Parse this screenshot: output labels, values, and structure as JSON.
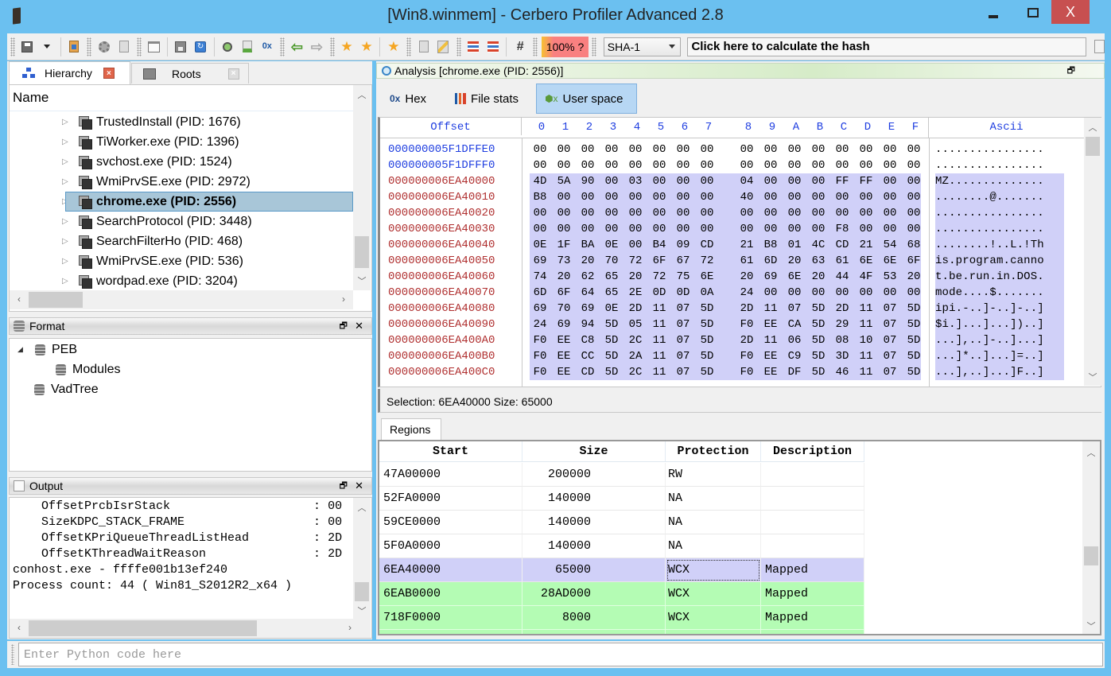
{
  "window": {
    "title": "[Win8.winmem] - Cerbero Profiler Advanced 2.8",
    "close_label": "X"
  },
  "toolbar": {
    "hash_progress": "100% ?",
    "hash_algorithm": "SHA-1",
    "hash_field": "Click here to calculate the hash",
    "icons": [
      "save-icon",
      "dropdown-icon",
      "import-icon",
      "settings-icon",
      "doc-settings-icon",
      "window-icon",
      "save-disk-icon",
      "refresh-icon",
      "zoom-icon",
      "add-doc-icon",
      "hex-add-icon",
      "back-arrow-icon",
      "forward-arrow-icon",
      "bookmark-globe-icon",
      "bookmark-star-icon",
      "add-bookmark-icon",
      "script-icon",
      "edit-icon",
      "layout-icon",
      "layout-search-icon",
      "hash-icon"
    ]
  },
  "left": {
    "tabs": [
      {
        "label": "Hierarchy",
        "active": true,
        "close": "×"
      },
      {
        "label": "Roots",
        "active": false,
        "close": "×"
      }
    ],
    "tree_header": "Name",
    "processes": [
      {
        "label": "TrustedInstall (PID: 1676)",
        "selected": false
      },
      {
        "label": "TiWorker.exe (PID: 1396)",
        "selected": false
      },
      {
        "label": "svchost.exe (PID: 1524)",
        "selected": false
      },
      {
        "label": "WmiPrvSE.exe (PID: 2972)",
        "selected": false
      },
      {
        "label": "chrome.exe (PID: 2556)",
        "selected": true
      },
      {
        "label": "SearchProtocol (PID: 3448)",
        "selected": false
      },
      {
        "label": "SearchFilterHo (PID: 468)",
        "selected": false
      },
      {
        "label": "WmiPrvSE.exe (PID: 536)",
        "selected": false
      },
      {
        "label": "wordpad.exe (PID: 3204)",
        "selected": false
      }
    ],
    "format": {
      "title": "Format",
      "items": [
        {
          "label": "PEB",
          "expanded": true,
          "level": 0
        },
        {
          "label": "Modules",
          "level": 1
        },
        {
          "label": "VadTree",
          "level": 0
        }
      ]
    },
    "output": {
      "title": "Output",
      "lines": [
        "    OffsetPrcbIsrStack                    : 00",
        "    SizeKDPC_STACK_FRAME                  : 00",
        "    OffsetKPriQueueThreadListHead         : 2D",
        "    OffsetKThreadWaitReason               : 2D",
        "conhost.exe - ffffe001b13ef240",
        "Process count: 44 ( Win81_S2012R2_x64 )"
      ]
    }
  },
  "python": {
    "placeholder": "Enter Python code here"
  },
  "analysis": {
    "title": "Analysis [chrome.exe (PID: 2556)]",
    "view_tabs": [
      {
        "label": "Hex",
        "icon": "0x"
      },
      {
        "label": "File stats",
        "icon": "bars"
      },
      {
        "label": "User space",
        "icon": "0x-green",
        "active": true
      }
    ],
    "hex": {
      "offset_header": "Offset",
      "columns": [
        "0",
        "1",
        "2",
        "3",
        "4",
        "5",
        "6",
        "7",
        "8",
        "9",
        "A",
        "B",
        "C",
        "D",
        "E",
        "F"
      ],
      "ascii_header": "Ascii",
      "rows": [
        {
          "addr": "000000005F1DFFE0",
          "hl": false,
          "bytes": [
            "00",
            "00",
            "00",
            "00",
            "00",
            "00",
            "00",
            "00",
            "00",
            "00",
            "00",
            "00",
            "00",
            "00",
            "00",
            "00"
          ],
          "ascii": "................"
        },
        {
          "addr": "000000005F1DFFF0",
          "hl": false,
          "bytes": [
            "00",
            "00",
            "00",
            "00",
            "00",
            "00",
            "00",
            "00",
            "00",
            "00",
            "00",
            "00",
            "00",
            "00",
            "00",
            "00"
          ],
          "ascii": "................"
        },
        {
          "addr": "000000006EA40000",
          "hl": true,
          "bytes": [
            "4D",
            "5A",
            "90",
            "00",
            "03",
            "00",
            "00",
            "00",
            "04",
            "00",
            "00",
            "00",
            "FF",
            "FF",
            "00",
            "00"
          ],
          "ascii": "MZ.............."
        },
        {
          "addr": "000000006EA40010",
          "hl": true,
          "bytes": [
            "B8",
            "00",
            "00",
            "00",
            "00",
            "00",
            "00",
            "00",
            "40",
            "00",
            "00",
            "00",
            "00",
            "00",
            "00",
            "00"
          ],
          "ascii": "........@......."
        },
        {
          "addr": "000000006EA40020",
          "hl": true,
          "bytes": [
            "00",
            "00",
            "00",
            "00",
            "00",
            "00",
            "00",
            "00",
            "00",
            "00",
            "00",
            "00",
            "00",
            "00",
            "00",
            "00"
          ],
          "ascii": "................"
        },
        {
          "addr": "000000006EA40030",
          "hl": true,
          "bytes": [
            "00",
            "00",
            "00",
            "00",
            "00",
            "00",
            "00",
            "00",
            "00",
            "00",
            "00",
            "00",
            "F8",
            "00",
            "00",
            "00"
          ],
          "ascii": "................"
        },
        {
          "addr": "000000006EA40040",
          "hl": true,
          "bytes": [
            "0E",
            "1F",
            "BA",
            "0E",
            "00",
            "B4",
            "09",
            "CD",
            "21",
            "B8",
            "01",
            "4C",
            "CD",
            "21",
            "54",
            "68"
          ],
          "ascii": "........!..L.!Th"
        },
        {
          "addr": "000000006EA40050",
          "hl": true,
          "bytes": [
            "69",
            "73",
            "20",
            "70",
            "72",
            "6F",
            "67",
            "72",
            "61",
            "6D",
            "20",
            "63",
            "61",
            "6E",
            "6E",
            "6F"
          ],
          "ascii": "is.program.canno"
        },
        {
          "addr": "000000006EA40060",
          "hl": true,
          "bytes": [
            "74",
            "20",
            "62",
            "65",
            "20",
            "72",
            "75",
            "6E",
            "20",
            "69",
            "6E",
            "20",
            "44",
            "4F",
            "53",
            "20"
          ],
          "ascii": "t.be.run.in.DOS."
        },
        {
          "addr": "000000006EA40070",
          "hl": true,
          "bytes": [
            "6D",
            "6F",
            "64",
            "65",
            "2E",
            "0D",
            "0D",
            "0A",
            "24",
            "00",
            "00",
            "00",
            "00",
            "00",
            "00",
            "00"
          ],
          "ascii": "mode....$......."
        },
        {
          "addr": "000000006EA40080",
          "hl": true,
          "bytes": [
            "69",
            "70",
            "69",
            "0E",
            "2D",
            "11",
            "07",
            "5D",
            "2D",
            "11",
            "07",
            "5D",
            "2D",
            "11",
            "07",
            "5D"
          ],
          "ascii": "ipi.-..]-..]-..]"
        },
        {
          "addr": "000000006EA40090",
          "hl": true,
          "bytes": [
            "24",
            "69",
            "94",
            "5D",
            "05",
            "11",
            "07",
            "5D",
            "F0",
            "EE",
            "CA",
            "5D",
            "29",
            "11",
            "07",
            "5D"
          ],
          "ascii": "$i.]...]...])..]"
        },
        {
          "addr": "000000006EA400A0",
          "hl": true,
          "bytes": [
            "F0",
            "EE",
            "C8",
            "5D",
            "2C",
            "11",
            "07",
            "5D",
            "2D",
            "11",
            "06",
            "5D",
            "08",
            "10",
            "07",
            "5D"
          ],
          "ascii": "...],..]-..]...]"
        },
        {
          "addr": "000000006EA400B0",
          "hl": true,
          "bytes": [
            "F0",
            "EE",
            "CC",
            "5D",
            "2A",
            "11",
            "07",
            "5D",
            "F0",
            "EE",
            "C9",
            "5D",
            "3D",
            "11",
            "07",
            "5D"
          ],
          "ascii": "...]*..]...]=..]"
        },
        {
          "addr": "000000006EA400C0",
          "hl": true,
          "bytes": [
            "F0",
            "EE",
            "CD",
            "5D",
            "2C",
            "11",
            "07",
            "5D",
            "F0",
            "EE",
            "DF",
            "5D",
            "46",
            "11",
            "07",
            "5D"
          ],
          "ascii": "...],..]...]F..]"
        }
      ]
    },
    "selection": "Selection: 6EA40000 Size: 65000",
    "regions_tab": "Regions",
    "regions": {
      "headers": [
        "Start",
        "Size",
        "Protection",
        "Description"
      ],
      "rows": [
        {
          "start": "47A00000",
          "size": "200000",
          "protection": "RW",
          "description": "",
          "state": "normal"
        },
        {
          "start": "52FA0000",
          "size": "140000",
          "protection": "NA",
          "description": "",
          "state": "normal"
        },
        {
          "start": "59CE0000",
          "size": "140000",
          "protection": "NA",
          "description": "",
          "state": "normal"
        },
        {
          "start": "5F0A0000",
          "size": "140000",
          "protection": "NA",
          "description": "",
          "state": "normal"
        },
        {
          "start": "6EA40000",
          "size": "65000",
          "protection": "WCX",
          "description": "Mapped",
          "state": "selected"
        },
        {
          "start": "6EAB0000",
          "size": "28AD000",
          "protection": "WCX",
          "description": "Mapped",
          "state": "mapped"
        },
        {
          "start": "718F0000",
          "size": "8000",
          "protection": "WCX",
          "description": "Mapped",
          "state": "mapped"
        }
      ]
    }
  },
  "colors": {
    "window_frame": "#6bc0f0",
    "close_button": "#c75050",
    "selection_highlight": "#d0d0f8",
    "mapped_region": "#b4fcb4",
    "selected_tree_item": "#a8c6d8",
    "offset_pre": "#1f3ee0",
    "offset_sel": "#b03030"
  }
}
